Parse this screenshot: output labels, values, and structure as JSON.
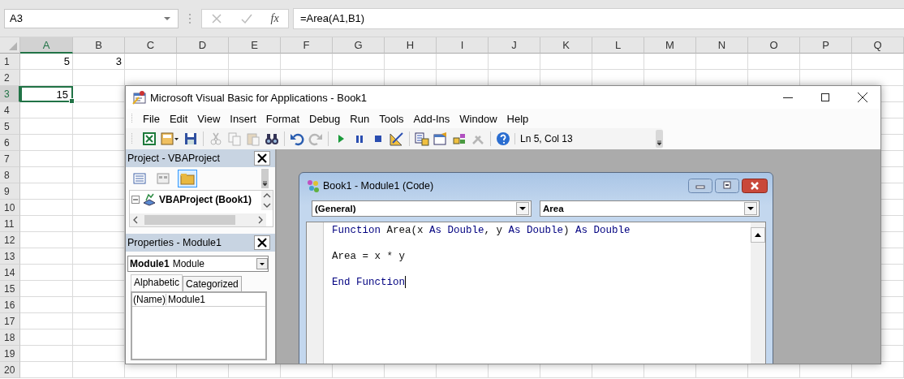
{
  "spreadsheet": {
    "name_box": "A3",
    "function_button": "fx",
    "formula": "=Area(A1,B1)",
    "columns": [
      {
        "label": "A",
        "selected": true
      },
      {
        "label": "B",
        "selected": false
      },
      {
        "label": "C",
        "selected": false
      },
      {
        "label": "D",
        "selected": false
      },
      {
        "label": "E",
        "selected": false
      },
      {
        "label": "F",
        "selected": false
      },
      {
        "label": "G",
        "selected": false
      },
      {
        "label": "H",
        "selected": false
      },
      {
        "label": "I",
        "selected": false
      },
      {
        "label": "J",
        "selected": false
      },
      {
        "label": "K",
        "selected": false
      },
      {
        "label": "L",
        "selected": false
      },
      {
        "label": "M",
        "selected": false
      },
      {
        "label": "N",
        "selected": false
      },
      {
        "label": "O",
        "selected": false
      },
      {
        "label": "P",
        "selected": false
      },
      {
        "label": "Q",
        "selected": false
      }
    ],
    "rows": [
      {
        "label": "1",
        "selected": false,
        "cells": [
          {
            "value": "5",
            "selected": false
          },
          {
            "value": "3",
            "selected": false
          }
        ]
      },
      {
        "label": "2",
        "selected": false
      },
      {
        "label": "3",
        "selected": true,
        "cells": [
          {
            "value": "15",
            "selected": true
          }
        ]
      },
      {
        "label": "4",
        "selected": false
      },
      {
        "label": "5",
        "selected": false
      },
      {
        "label": "6",
        "selected": false
      },
      {
        "label": "7",
        "selected": false
      },
      {
        "label": "8",
        "selected": false
      },
      {
        "label": "9",
        "selected": false
      },
      {
        "label": "10",
        "selected": false
      },
      {
        "label": "11",
        "selected": false
      },
      {
        "label": "12",
        "selected": false
      },
      {
        "label": "13",
        "selected": false
      },
      {
        "label": "14",
        "selected": false
      },
      {
        "label": "15",
        "selected": false
      },
      {
        "label": "16",
        "selected": false
      },
      {
        "label": "17",
        "selected": false
      },
      {
        "label": "18",
        "selected": false
      },
      {
        "label": "19",
        "selected": false
      },
      {
        "label": "20",
        "selected": false
      }
    ]
  },
  "vba_window": {
    "title": "Microsoft Visual Basic for Applications - Book1",
    "menu": [
      "File",
      "Edit",
      "View",
      "Insert",
      "Format",
      "Debug",
      "Run",
      "Tools",
      "Add-Ins",
      "Window",
      "Help"
    ],
    "toolbar": [
      {
        "kind": "excel",
        "disabled": false
      },
      {
        "kind": "module",
        "disabled": false
      },
      {
        "kind": "save",
        "disabled": false
      },
      {
        "kind": "sep"
      },
      {
        "kind": "cut",
        "disabled": true
      },
      {
        "kind": "copy",
        "disabled": true
      },
      {
        "kind": "paste",
        "disabled": true
      },
      {
        "kind": "find",
        "disabled": false
      },
      {
        "kind": "sep"
      },
      {
        "kind": "undo",
        "disabled": false
      },
      {
        "kind": "redo",
        "disabled": true
      },
      {
        "kind": "sep"
      },
      {
        "kind": "run",
        "disabled": false
      },
      {
        "kind": "pause",
        "disabled": false
      },
      {
        "kind": "stop",
        "disabled": false
      },
      {
        "kind": "design",
        "disabled": false
      },
      {
        "kind": "sep"
      },
      {
        "kind": "explorer",
        "disabled": false
      },
      {
        "kind": "properties",
        "disabled": false
      },
      {
        "kind": "browser",
        "disabled": false
      },
      {
        "kind": "toolbox",
        "disabled": true
      },
      {
        "kind": "sep"
      },
      {
        "kind": "help",
        "disabled": false
      }
    ],
    "position": "Ln 5, Col 13",
    "project_panel": {
      "title": "Project - VBAProject",
      "tools": [
        {
          "kind": "code",
          "selected": false
        },
        {
          "kind": "object",
          "selected": false
        },
        {
          "kind": "folders",
          "selected": true
        }
      ],
      "tree": [
        {
          "label": "VBAProject (Book1)",
          "expanded": true
        }
      ]
    },
    "properties_panel": {
      "title": "Properties - Module1",
      "object_name": "Module1",
      "object_type": "Module",
      "tabs": [
        {
          "label": "Alphabetic",
          "selected": true
        },
        {
          "label": "Categorized",
          "selected": false
        }
      ],
      "properties": [
        {
          "name": "(Name)",
          "value": "Module1"
        }
      ]
    },
    "code_window": {
      "title": "Book1 - Module1 (Code)",
      "object": "(General)",
      "procedure": "Area",
      "lines": [
        {
          "caret": false,
          "tokens": [
            {
              "kind": "keyword",
              "text": "Function "
            },
            {
              "kind": "plain",
              "text": "Area(x "
            },
            {
              "kind": "keyword",
              "text": "As Double"
            },
            {
              "kind": "plain",
              "text": ", y "
            },
            {
              "kind": "keyword",
              "text": "As Double"
            },
            {
              "kind": "plain",
              "text": ") "
            },
            {
              "kind": "keyword",
              "text": "As Double"
            }
          ]
        },
        {
          "caret": false,
          "tokens": [
            {
              "kind": "plain",
              "text": "Area = x * y"
            }
          ]
        },
        {
          "caret": true,
          "tokens": [
            {
              "kind": "keyword",
              "text": "End Function"
            }
          ]
        }
      ]
    }
  }
}
